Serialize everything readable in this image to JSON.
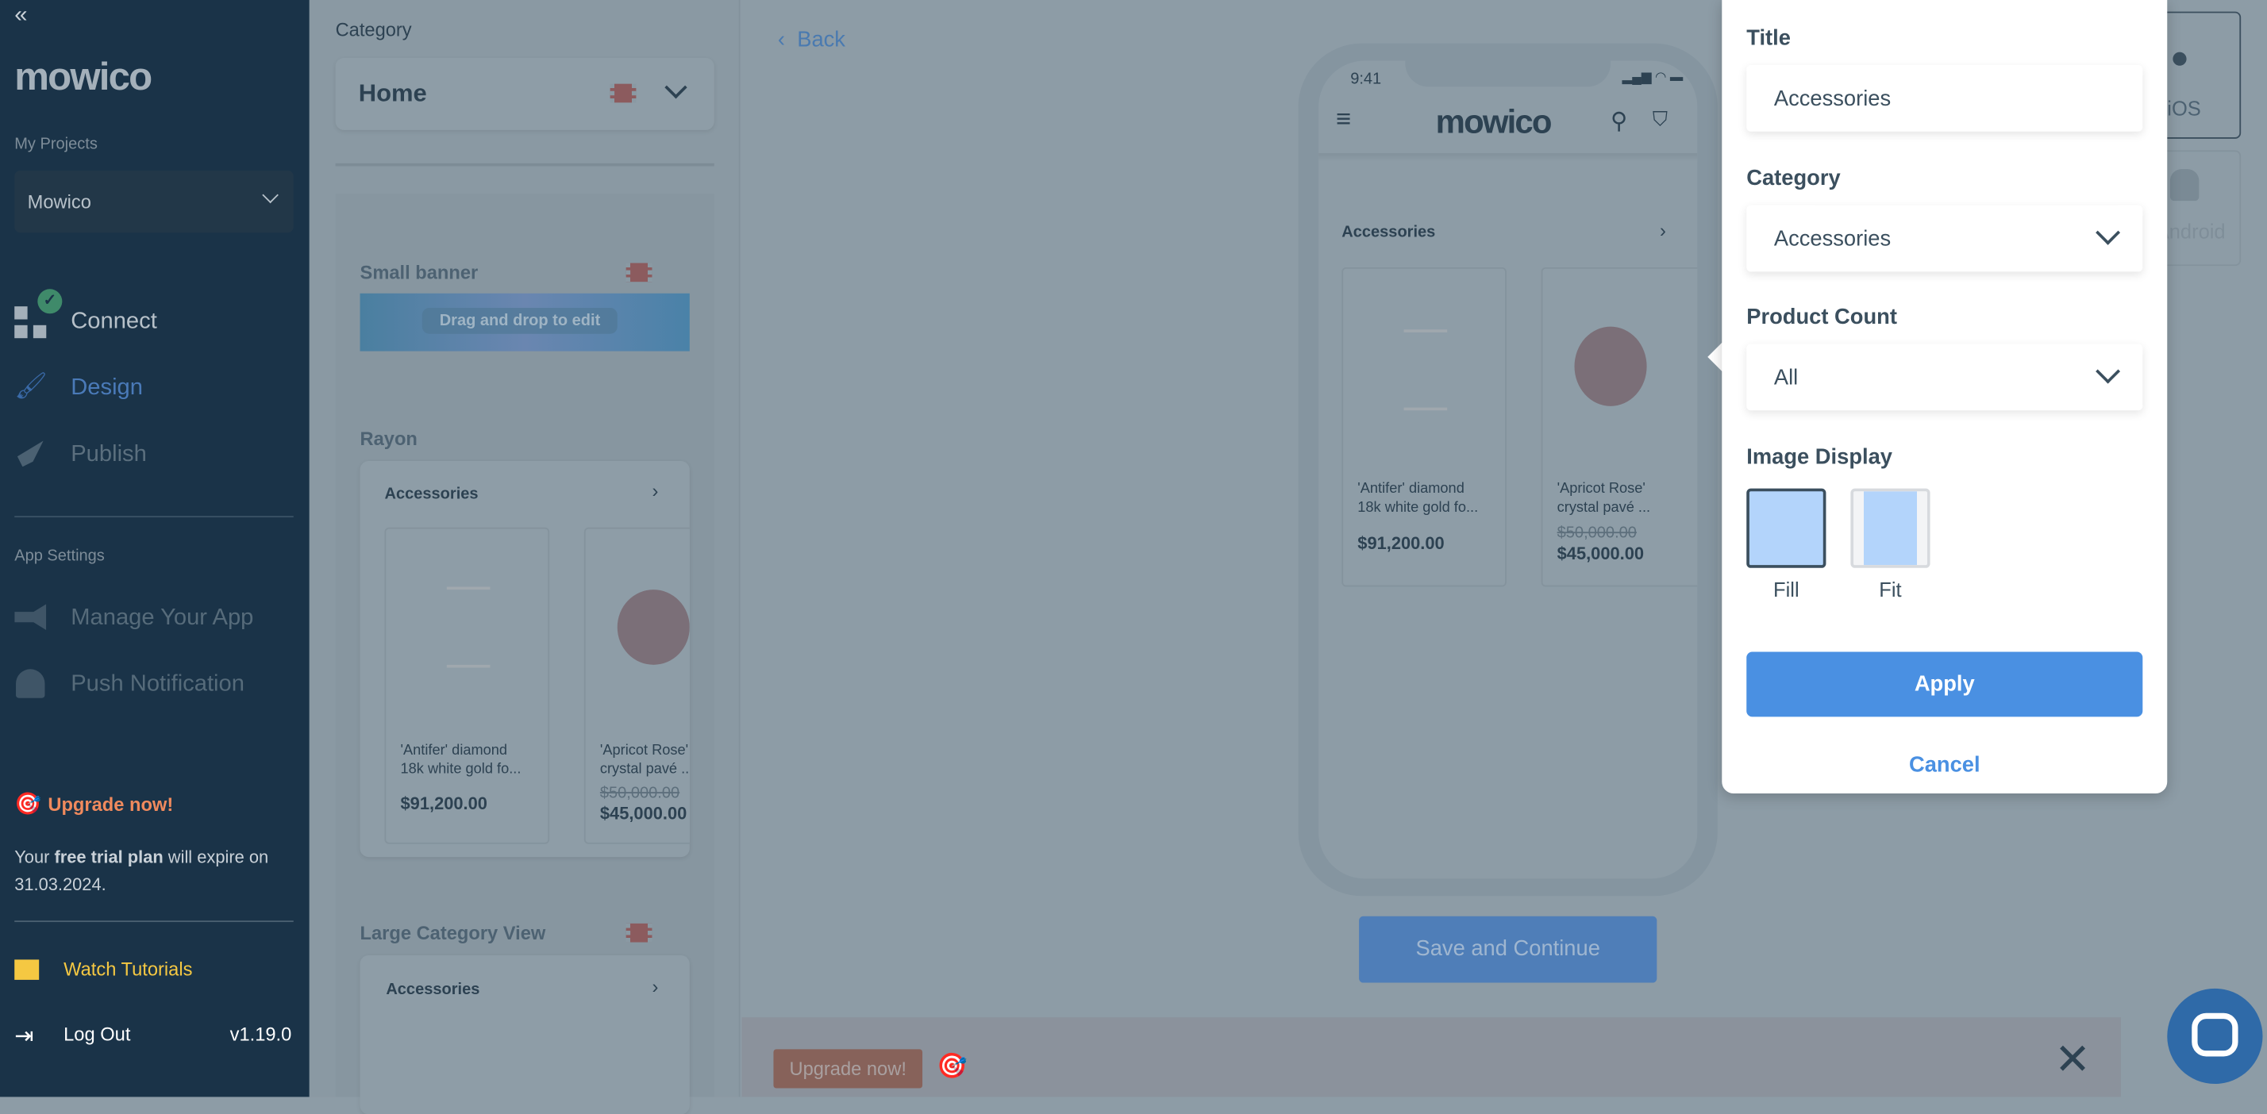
{
  "sidebar": {
    "collapse_icon": "double-chevron-left",
    "logo": "mowico",
    "my_projects_label": "My Projects",
    "project": "Mowico",
    "nav": [
      {
        "label": "Connect",
        "icon": "grid-check"
      },
      {
        "label": "Design",
        "icon": "paintbrush"
      },
      {
        "label": "Publish",
        "icon": "rocket"
      }
    ],
    "app_settings_label": "App Settings",
    "settings": [
      {
        "label": "Manage Your App",
        "icon": "megaphone"
      },
      {
        "label": "Push Notification",
        "icon": "bell"
      }
    ],
    "upgrade": "Upgrade now!",
    "trial_pre": "Your ",
    "trial_bold": "free trial plan",
    "trial_post": " will expire on",
    "trial_date": "31.03.2024.",
    "watch_tutorials": "Watch Tutorials",
    "logout": "Log Out",
    "version": "v1.19.0"
  },
  "category_panel": {
    "label": "Category",
    "selected": "Home",
    "small_banner": {
      "title": "Small banner",
      "overlay": "Drag and drop to edit"
    },
    "rayon": {
      "title": "Rayon",
      "category": "Accessories"
    },
    "large_category": {
      "title": "Large Category View",
      "category": "Accessories"
    }
  },
  "products": [
    {
      "name1": "'Antifer' diamond",
      "name2": "18k white gold fo...",
      "price": "$91,200.00",
      "old_price": ""
    },
    {
      "name1": "'Apricot Rose'",
      "name2": "crystal pavé ...",
      "price": "$45,000.00",
      "old_price": "$50,000.00"
    }
  ],
  "preview": {
    "back": "Back",
    "time": "9:41",
    "logo": "mowico",
    "section": "Accessories",
    "save": "Save and Continue",
    "platforms": [
      "iOS",
      "Android"
    ],
    "upgrade": "Upgrade now!"
  },
  "popover": {
    "title_label": "Title",
    "title_value": "Accessories",
    "category_label": "Category",
    "category_value": "Accessories",
    "count_label": "Product Count",
    "count_value": "All",
    "display_label": "Image Display",
    "display_options": [
      "Fill",
      "Fit"
    ],
    "display_selected": "Fill",
    "apply": "Apply",
    "cancel": "Cancel"
  },
  "colors": {
    "accent": "#4a90e2",
    "sidebar": "#1a3348",
    "upgrade": "#f08a5d",
    "tutorials": "#f5c842"
  }
}
